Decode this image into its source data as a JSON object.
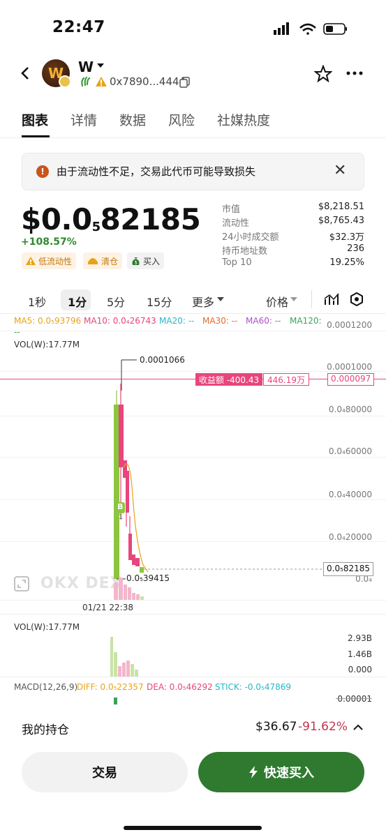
{
  "status_bar": {
    "time": "22:47"
  },
  "header": {
    "token_name": "W",
    "avatar_letter": "W",
    "address": "0x7890...4444"
  },
  "tabs": [
    "图表",
    "详情",
    "数据",
    "风险",
    "社媒热度"
  ],
  "warning": {
    "text": "由于流动性不足，交易此代币可能导致损失"
  },
  "price": {
    "main": "$0.0",
    "sub": "5",
    "rest": "82185",
    "change": "+108.57%"
  },
  "tags": [
    "低流动性",
    "清仓",
    "买入"
  ],
  "stats": [
    {
      "label": "市值",
      "value": "$8,218.51"
    },
    {
      "label": "流动性",
      "value": "$8,765.43"
    },
    {
      "label": "24小时成交额",
      "value": "$32.3万"
    },
    {
      "label": "持币地址数",
      "value": "236"
    },
    {
      "label": "Top 10",
      "value": "19.25%"
    }
  ],
  "timeframes": [
    "1秒",
    "1分",
    "5分",
    "15分",
    "更多"
  ],
  "price_toggle": "价格",
  "ma": {
    "ma5": "MA5: 0.0₅93796",
    "ma10": "MA10: 0.0₄26743",
    "ma20": "MA20: --",
    "ma30": "MA30: --",
    "ma60": "MA60: --",
    "ma120": "MA120:",
    "ma120_cont": "--"
  },
  "vol_label": "VOL(W):17.77M",
  "y_axis": [
    "0.0001200",
    "0.0001000",
    "0.0₄80000",
    "0.0₄60000",
    "0.0₄40000",
    "0.0₄20000",
    "0.0₄"
  ],
  "high_label": "0.0001066",
  "low_label": "0.0₅39415",
  "profit_label": "收益额 -400.43",
  "profit_value": "446.19万",
  "price_line": "0.000097",
  "current_price": "0.0₅82185",
  "x_label": "01/21 22:38",
  "b_marker": "B",
  "b_count": "1",
  "vol_panel": {
    "label": "VOL(W):17.77M",
    "axis": [
      "2.93B",
      "1.46B",
      "0.000"
    ]
  },
  "macd": {
    "label": "MACD(12,26,9)",
    "diff": "DIFF: 0.0₅22357",
    "dea": "DEA: 0.0₅46292",
    "stick": "STICK: -0.0₅47869",
    "axis": "0.00001"
  },
  "watermark": "OKX DEX",
  "holdings": {
    "label": "我的持仓",
    "value": "$36.67",
    "pct": "-91.62%"
  },
  "buttons": {
    "trade": "交易",
    "quick_buy": "快速买入"
  },
  "colors": {
    "up": "#8cc63f",
    "down": "#e8457d",
    "accent_green": "#2f7a2f",
    "pink": "#e8457d"
  }
}
